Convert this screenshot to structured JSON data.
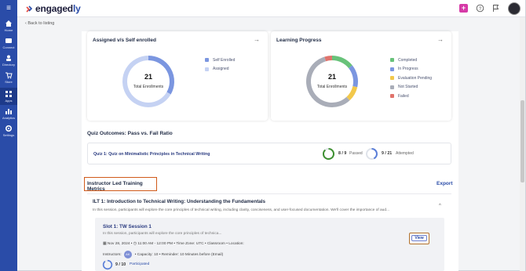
{
  "sidebar": {
    "items": [
      {
        "label": "Home",
        "icon": "home-icon"
      },
      {
        "label": "Connect",
        "icon": "connect-icon"
      },
      {
        "label": "Directory",
        "icon": "directory-icon"
      },
      {
        "label": "Store",
        "icon": "cart-icon"
      },
      {
        "label": "Apps",
        "icon": "apps-icon",
        "active": true
      },
      {
        "label": "Analytics",
        "icon": "analytics-icon"
      },
      {
        "label": "Settings",
        "icon": "gear-icon"
      }
    ]
  },
  "topbar": {
    "logo_text": "engaged",
    "logo_suffix": "ly",
    "plus_label": "+"
  },
  "nav": {
    "back_label": "Back to listing"
  },
  "assigned_card": {
    "title": "Assigned v/s Self enrolled",
    "total": "21",
    "total_label": "Total Enrollments",
    "legend": [
      {
        "label": "Self Enrolled",
        "color": "#7b96e0"
      },
      {
        "label": "Assigned",
        "color": "#c5d2f3"
      }
    ],
    "chart_data": {
      "type": "pie",
      "categories": [
        "Self Enrolled",
        "Assigned"
      ],
      "values": [
        7,
        14
      ]
    }
  },
  "progress_card": {
    "title": "Learning Progress",
    "total": "21",
    "total_label": "Total Enrollments",
    "legend": [
      {
        "label": "Completed",
        "color": "#68c27a"
      },
      {
        "label": "In Progress",
        "color": "#7b96e0"
      },
      {
        "label": "Evaluation Pending",
        "color": "#f2c84b"
      },
      {
        "label": "Not Started",
        "color": "#a9adb8"
      },
      {
        "label": "Failed",
        "color": "#e0736c"
      }
    ],
    "chart_data": {
      "type": "pie",
      "categories": [
        "Completed",
        "In Progress",
        "Evaluation Pending",
        "Not Started",
        "Failed"
      ],
      "values": [
        3,
        3,
        2,
        12,
        1
      ]
    }
  },
  "quiz": {
    "section_title": "Quiz Outcomes: Pass vs. Fail Ratio",
    "label": "Quiz 1: Quiz on Minimalistic Principles in Technical Writing",
    "passed_value": "8 / 9",
    "passed_label": "Passed",
    "passed_fraction": 0.889,
    "attempted_value": "9 / 21",
    "attempted_label": "Attempted",
    "attempted_fraction": 0.429
  },
  "ilt": {
    "section_title": "Instructor Led Training Metrics",
    "export_label": "Export",
    "title": "ILT 1: Introduction to Technical Writing: Understanding the Fundamentals",
    "description": "In this session, participants will explore the core principles of technical writing, including clarity, conciseness, and user-focused documentation. We'll cover the importance of aud...",
    "caret": "^"
  },
  "slot": {
    "title": "Slot 1: TW Session 1",
    "description": "In this session, participants will explore the core principles of technica...",
    "date": "Nov 28, 2024",
    "time": "11:00 AM - 12:00 PM",
    "timezone": "Time Zone: UTC",
    "mode": "Classroom",
    "location": "Location:",
    "instructors_label": "Instructors:",
    "instructor_initials": "AK",
    "capacity": "Capacity: 10",
    "reminder": "Reminder: 10 Minutes before (Email)",
    "view_label": "View",
    "participated_value": "9 / 10",
    "participated_label": "Participated",
    "participated_fraction": 0.9
  }
}
